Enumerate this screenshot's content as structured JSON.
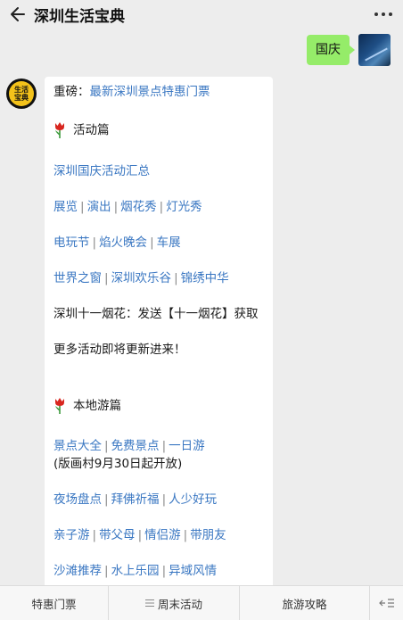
{
  "header": {
    "title": "深圳生活宝典"
  },
  "outgoing": {
    "text": "国庆"
  },
  "bot_avatar": {
    "line1": "生活",
    "line2": "宝典"
  },
  "message": {
    "headline_prefix": "重磅：",
    "headline_link": "最新深圳景点特惠门票",
    "section1_title": "活动篇",
    "s1_link1": "深圳国庆活动汇总",
    "row1": [
      "展览",
      "演出",
      "烟花秀",
      "灯光秀"
    ],
    "row2": [
      "电玩节",
      "焰火晚会",
      "车展"
    ],
    "row3": [
      "世界之窗",
      "深圳欢乐谷",
      "锦绣中华"
    ],
    "fireworks_text": "深圳十一烟花：发送【十一烟花】获取",
    "more_text": "更多活动即将更新进来！",
    "section2_title": "本地游篇",
    "row4": [
      "景点大全",
      "免费景点",
      "一日游"
    ],
    "row4_note": "(版画村9月30日起开放)",
    "row5": [
      "夜场盘点",
      "拜佛祈福",
      "人少好玩"
    ],
    "row6": [
      "亲子游",
      "带父母",
      "情侣游",
      "带朋友"
    ],
    "row7": [
      "沙滩推荐",
      "水上乐园",
      "异域风情"
    ],
    "separator": "|"
  },
  "bottom_tabs": [
    "特惠门票",
    "周末活动",
    "旅游攻略"
  ]
}
